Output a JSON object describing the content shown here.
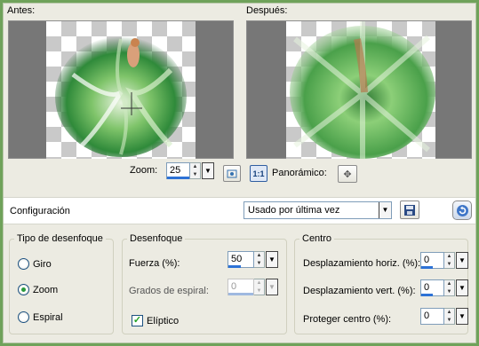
{
  "labels": {
    "before": "Antes:",
    "after": "Después:"
  },
  "zoom": {
    "label": "Zoom:",
    "value": "25",
    "pan_label": "Panorámico:",
    "one_to_one": "1:1"
  },
  "config": {
    "label": "Configuración",
    "preset": "Usado por última vez"
  },
  "blur_type": {
    "title": "Tipo de desenfoque",
    "options": [
      "Giro",
      "Zoom",
      "Espiral"
    ],
    "selected": "Zoom"
  },
  "blur": {
    "title": "Desenfoque",
    "strength_label": "Fuerza (%):",
    "strength_value": "50",
    "spiral_label": "Grados de espiral:",
    "spiral_value": "0",
    "elliptic_label": "Elíptico",
    "elliptic_checked": true
  },
  "center": {
    "title": "Centro",
    "horiz_label": "Desplazamiento horiz. (%):",
    "horiz_value": "0",
    "vert_label": "Desplazamiento vert. (%):",
    "vert_value": "0",
    "protect_label": "Proteger centro (%):",
    "protect_value": "0"
  },
  "colors": {
    "accent": "#2d72d6",
    "frame": "#6fa25a",
    "panel": "#ecebe2"
  }
}
